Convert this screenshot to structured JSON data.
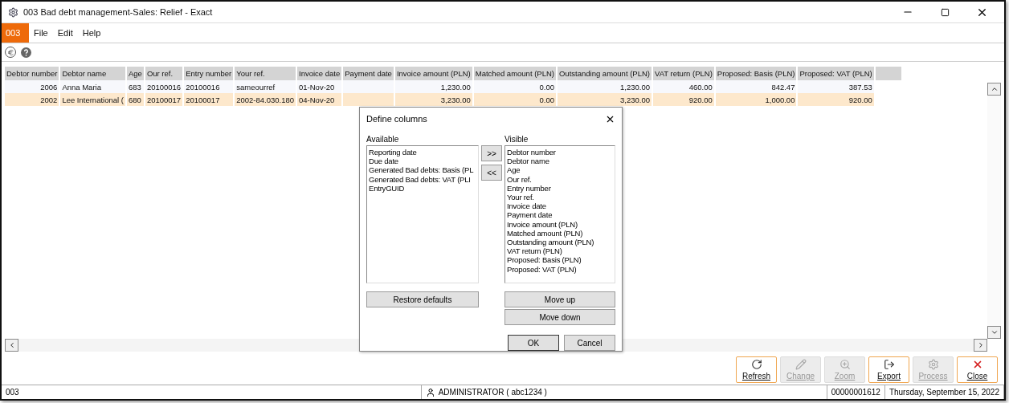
{
  "window": {
    "title": "003 Bad debt management-Sales: Relief - Exact"
  },
  "company_badge": "003",
  "menu": [
    {
      "label": "File"
    },
    {
      "label": "Edit"
    },
    {
      "label": "Help"
    }
  ],
  "table": {
    "columns": [
      {
        "label": "Debtor number",
        "kind": "number"
      },
      {
        "label": "Debtor name",
        "kind": "text"
      },
      {
        "label": "Age",
        "kind": "text"
      },
      {
        "label": "Our ref.",
        "kind": "text"
      },
      {
        "label": "Entry number",
        "kind": "text"
      },
      {
        "label": "Your ref.",
        "kind": "text"
      },
      {
        "label": "Invoice date",
        "kind": "text"
      },
      {
        "label": "Payment date",
        "kind": "text"
      },
      {
        "label": "Invoice amount (PLN)",
        "kind": "number"
      },
      {
        "label": "Matched amount (PLN)",
        "kind": "number"
      },
      {
        "label": "Outstanding amount (PLN)",
        "kind": "number"
      },
      {
        "label": "VAT return (PLN)",
        "kind": "number"
      },
      {
        "label": "Proposed: Basis (PLN)",
        "kind": "number"
      },
      {
        "label": "Proposed: VAT (PLN)",
        "kind": "number"
      }
    ],
    "rows": [
      {
        "selected": false,
        "cells": [
          "2006",
          "Anna Maria",
          "683",
          "20100016",
          "20100016",
          "sameourref",
          "01-Nov-20",
          "",
          "1,230.00",
          "0.00",
          "1,230.00",
          "460.00",
          "842.47",
          "387.53"
        ]
      },
      {
        "selected": true,
        "cells": [
          "2002",
          "Lee International (",
          "680",
          "20100017",
          "20100017",
          "2002-84.030.180",
          "04-Nov-20",
          "",
          "3,230.00",
          "0.00",
          "3,230.00",
          "920.00",
          "1,000.00",
          "920.00"
        ]
      }
    ]
  },
  "dialog": {
    "title": "Define columns",
    "available_label": "Available",
    "available_items": [
      "Reporting date",
      "Due date",
      "Generated Bad debts: Basis (PL",
      "Generated Bad debts: VAT (PLI",
      "EntryGUID"
    ],
    "add_button": ">>",
    "remove_button": "<<",
    "visible_label": "Visible",
    "visible_items": [
      "Debtor number",
      "Debtor name",
      "Age",
      "Our ref.",
      "Entry number",
      "Your ref.",
      "Invoice date",
      "Payment date",
      "Invoice amount (PLN)",
      "Matched amount (PLN)",
      "Outstanding amount (PLN)",
      "VAT return (PLN)",
      "Proposed: Basis (PLN)",
      "Proposed: VAT (PLN)"
    ],
    "restore_button": "Restore defaults",
    "move_up_button": "Move up",
    "move_down_button": "Move down",
    "ok_button": "OK",
    "cancel_button": "Cancel"
  },
  "actions": [
    {
      "label": "Refresh",
      "kind": "refresh",
      "disabled": false
    },
    {
      "label": "Change",
      "kind": "change",
      "disabled": true
    },
    {
      "label": "Zoom",
      "kind": "zoom",
      "disabled": true
    },
    {
      "label": "Export",
      "kind": "export",
      "disabled": false
    },
    {
      "label": "Process",
      "kind": "process",
      "disabled": true
    },
    {
      "label": "Close",
      "kind": "close",
      "disabled": false
    }
  ],
  "status_bar": {
    "company": "003",
    "user": "ADMINISTRATOR ( abc1234 )",
    "record": "00000001612",
    "date": "Thursday, September 15, 2022"
  }
}
